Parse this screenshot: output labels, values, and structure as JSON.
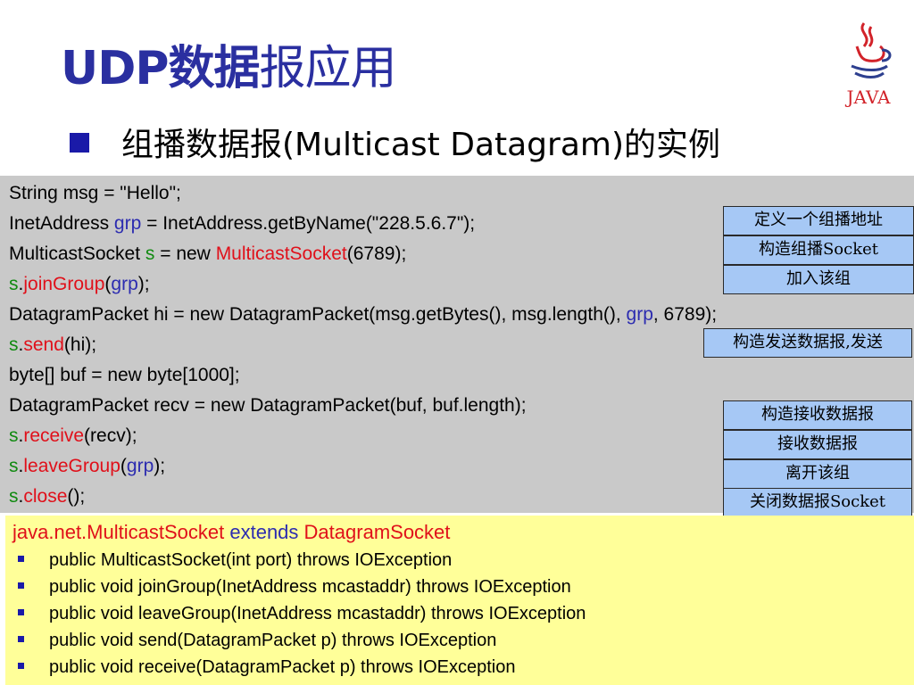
{
  "title": {
    "part1": "UDP数据",
    "part2": "报应用"
  },
  "subtitle": {
    "cn_prefix": "组播数据报",
    "latin": "(Multicast Datagram)",
    "cn_suffix": "的实例"
  },
  "logo": {
    "text": "JAVA",
    "icon": "java-coffee-cup-icon"
  },
  "code": {
    "l1": "String msg = \"Hello\";",
    "l2a": "InetAddress ",
    "l2b": "grp",
    "l2c": " = InetAddress.getByName(\"228.5.6.7\");",
    "l3a": "MulticastSocket ",
    "l3b": "s",
    "l3c": " = new ",
    "l3d": "MulticastSocket",
    "l3e": "(6789);",
    "l4a": "s",
    "l4b": ".",
    "l4c": "joinGroup",
    "l4d": "(",
    "l4e": "grp",
    "l4f": ");",
    "l5a": "DatagramPacket hi = new DatagramPacket(msg.getBytes(), msg.length(),  ",
    "l5b": "grp",
    "l5c": ", 6789);",
    "l6a": "s",
    "l6b": ".",
    "l6c": "send",
    "l6d": "(hi);",
    "l7": "byte[] buf = new byte[1000];",
    "l8": "DatagramPacket recv = new DatagramPacket(buf, buf.length);",
    "l9a": "s",
    "l9b": ".",
    "l9c": "receive",
    "l9d": "(recv);",
    "l10a": "s",
    "l10b": ".",
    "l10c": "leaveGroup",
    "l10d": "(",
    "l10e": "grp",
    "l10f": ");",
    "l11a": "s",
    "l11b": ".",
    "l11c": "close",
    "l11d": "();"
  },
  "notes": [
    "定义一个组播地址",
    "构造组播Socket",
    "加入该组",
    "构造发送数据报,发送",
    "构造接收数据报",
    "接收数据报",
    "离开该组",
    "关闭数据报Socket"
  ],
  "api": {
    "class": "java.net.MulticastSocket",
    "extends": "extends",
    "parent": "DatagramSocket",
    "methods": [
      "public MulticastSocket(int port) throws IOException",
      "public void joinGroup(InetAddress mcastaddr) throws IOException",
      "public void leaveGroup(InetAddress mcastaddr) throws IOException",
      "public void send(DatagramPacket p) throws IOException",
      "public void receive(DatagramPacket p) throws IOException"
    ]
  },
  "colors": {
    "title": "#2a2fa0",
    "code_bg": "#c9c9c9",
    "note_bg": "#a6c8f5",
    "api_bg": "#ffff99",
    "keyword_red": "#e0101a",
    "var_green": "#108a10",
    "var_blue": "#2c2cb0"
  }
}
